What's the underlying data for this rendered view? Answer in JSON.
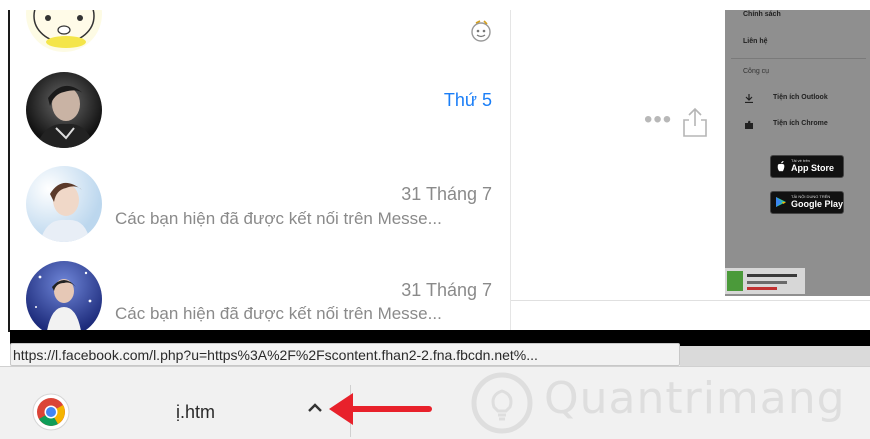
{
  "chats": [
    {
      "date": "",
      "preview": ""
    },
    {
      "date": "Thứ 5",
      "preview": ""
    },
    {
      "date": "31 Tháng 7",
      "preview": "Các bạn hiện đã được kết nối trên Messe..."
    },
    {
      "date": "31 Tháng 7",
      "preview": "Các bạn hiện đã được kết nối trên Messe..."
    }
  ],
  "right_panel": {
    "policy": "Chính sách",
    "contact": "Liên hệ",
    "tools_heading": "Công cụ",
    "outlook_ext": "Tiện ích Outlook",
    "chrome_ext": "Tiện ích Chrome",
    "app_store_sub": "Tải về trên",
    "app_store": "App Store",
    "google_play_sub": "TẢI NỘI DUNG TRÊN",
    "google_play": "Google Play"
  },
  "status_url": "https://l.facebook.com/l.php?u=https%3A%2F%2Fscontent.fhan2-2.fna.fbcdn.net%...",
  "download": {
    "file_name": "ị.htm"
  },
  "watermark": "Quantrimang",
  "colors": {
    "accent_blue": "#1a7ef7",
    "arrow_red": "#e8212b",
    "panel_grey": "#8f8f8f"
  }
}
